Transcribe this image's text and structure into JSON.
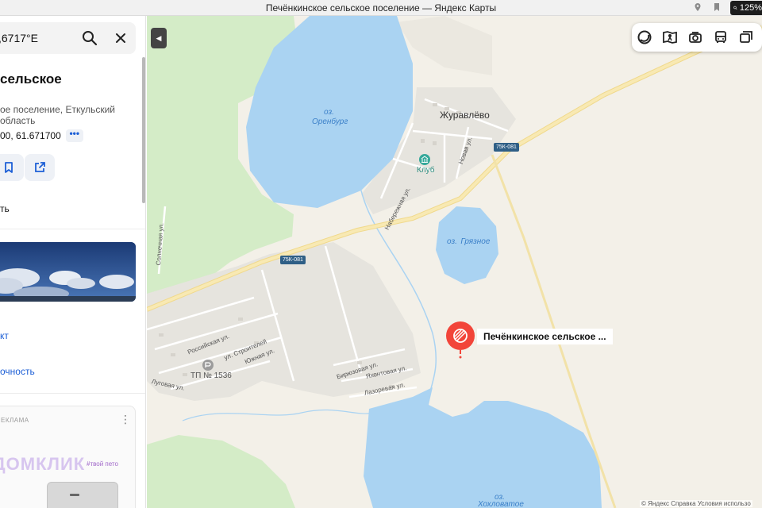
{
  "browser": {
    "title": "Печёнкинское сельское поселение — Яндекс Карты",
    "zoom": "125%"
  },
  "panel": {
    "search_value": ",6717°E",
    "title": "сельское",
    "subtitle": "ое поселение, Еткульский область",
    "coords": "00, 61.671700",
    "more": "•••",
    "item_1": "ть",
    "link_1": "кт",
    "link_2": "очность",
    "ad": {
      "label": "ЕКЛАМА",
      "menu": "⋮",
      "tag": "#твой пето",
      "brand": "ДОМКЛИК"
    }
  },
  "map": {
    "collapse": "◀",
    "labels": {
      "village": "Журавлёво",
      "club": "Клуб",
      "tp": "ТП № 1536"
    },
    "water": {
      "orenburg_prefix": "оз.",
      "orenburg": "Оренбург",
      "gryaznoe_prefix": "оз.",
      "gryaznoe": "Грязное",
      "khokhlovatoe_prefix": "оз.",
      "khokhlovatoe": "Хохловатое"
    },
    "streets": {
      "naberezhnaya": "Набережная ул.",
      "novaya": "Новая ул.",
      "solnechnaya": "Солнечная ул.",
      "rossiyskaya": "Российская ул.",
      "stroiteley": "ул. Строителей",
      "yuzhnaya": "Южная ул.",
      "lugovaya": "Луговая ул.",
      "biryuzovaya": "Бирюзовая ул.",
      "yakhontovaya": "Яхонтовая ул.",
      "lazorevaya": "Лазоревая ул."
    },
    "road_badges": [
      "75К-081",
      "75К-081"
    ],
    "pin_label": "Печёнкинское сельское ...",
    "footer": "© Яндекс  Справка  Условия использо"
  },
  "colors": {
    "water": "#aad3f2",
    "forest": "#d4ecc7",
    "land": "#f3f0e8",
    "settlement": "#e8e6e0",
    "road_major": "#f8e6a6",
    "pin": "#f2453a",
    "link": "#1d5fd6"
  },
  "icons": [
    "search-icon",
    "close-icon",
    "bookmark-icon",
    "share-icon",
    "location-icon",
    "bookmark-tab-icon",
    "zoom-icon",
    "layers-icon",
    "panorama-icon",
    "camera-icon",
    "transit-icon",
    "traffic-icon",
    "club-icon",
    "tp-icon",
    "pin-icon"
  ]
}
